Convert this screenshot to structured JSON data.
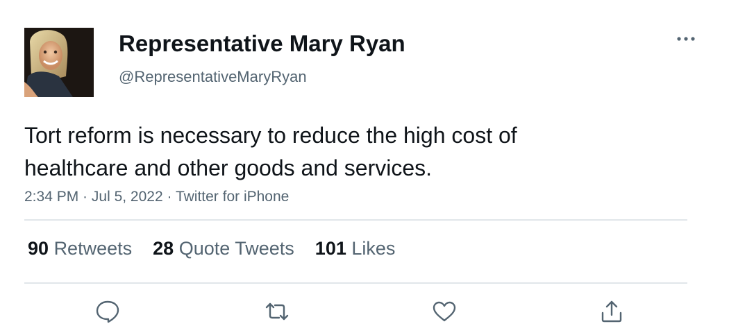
{
  "tweet": {
    "author": {
      "display_name": "Representative Mary Ryan",
      "handle": "@RepresentativeMaryRyan"
    },
    "text": "Tort reform is necessary to reduce the high cost of\nhealthcare and other goods and services.",
    "meta": {
      "time": "2:34 PM",
      "separator": " · ",
      "date": "Jul 5, 2022",
      "source": "Twitter for iPhone"
    },
    "stats": {
      "retweets_count": "90",
      "retweets_label": "Retweets",
      "quote_count": "28",
      "quote_label": "Quote Tweets",
      "likes_count": "101",
      "likes_label": "Likes"
    },
    "icons": {
      "more": "more-horizontal-icon",
      "reply": "reply-icon",
      "retweet": "retweet-icon",
      "like": "heart-icon",
      "share": "share-icon"
    },
    "colors": {
      "text_primary": "#0f1419",
      "text_secondary": "#536471",
      "divider": "#e1e6ea"
    }
  }
}
